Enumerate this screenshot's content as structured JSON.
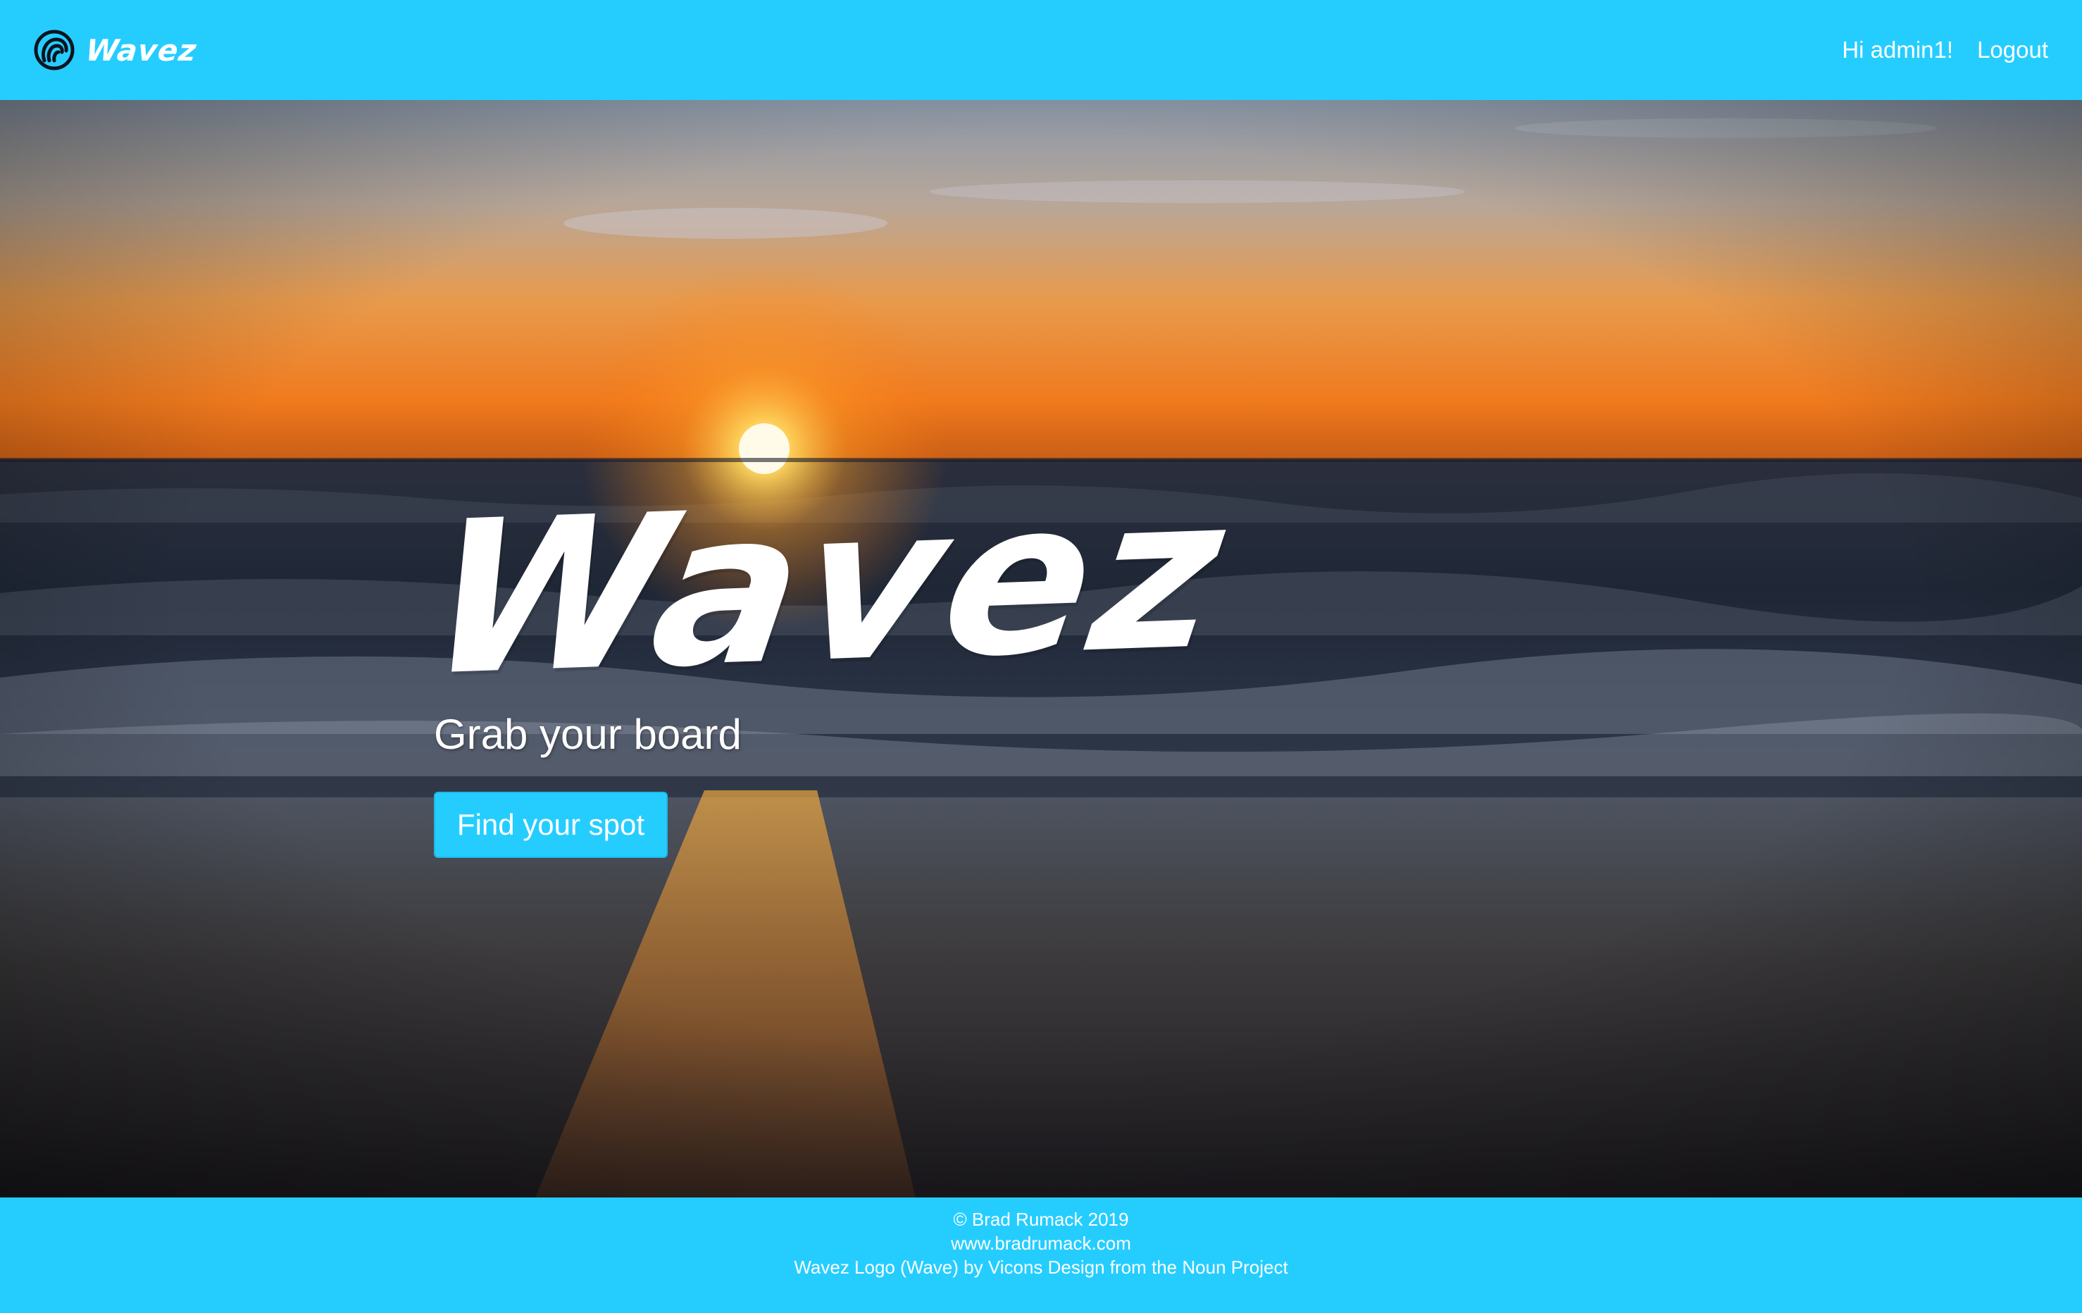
{
  "navbar": {
    "brand_name": "Wavez",
    "brand_icon": "wave-logo-icon",
    "greeting": "Hi admin1!",
    "logout_label": "Logout"
  },
  "hero": {
    "title": "Wavez",
    "subtitle": "Grab your board",
    "cta_label": "Find your spot",
    "background": "sunset-beach-photo"
  },
  "footer": {
    "copyright": "© Brad Rumack 2019",
    "website": "www.bradrumack.com",
    "credit": "Wavez Logo (Wave) by Vicons Design from the Noun Project"
  },
  "colors": {
    "accent": "#25cdff",
    "text": "#ffffff"
  }
}
